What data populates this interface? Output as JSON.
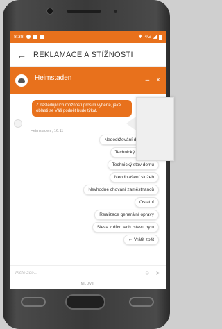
{
  "status_bar": {
    "time": "8:38",
    "network": "4G"
  },
  "app_bar": {
    "back_glyph": "←",
    "title": "REKLAMACE A STÍŽNOSTI"
  },
  "chat_header": {
    "name": "Heimstaden",
    "minimize_glyph": "–",
    "close_glyph": "×"
  },
  "message": {
    "text": "Z následujících možností prosím vyberte, jaké oblasti se Váš podnět bude týkat.",
    "meta": "Heimstaden , 16:11"
  },
  "options": [
    "Nedodržování dom. řádu",
    "Technický stav bytu",
    "Technický stav domu",
    "Neodhlášení služeb",
    "Nevhodné chování zaměstnanců",
    "Ostatní",
    "Realizace generální opravy",
    "Sleva z dův. tech. stavu bytu",
    "← Vrátit zpět"
  ],
  "input": {
    "placeholder": "Pište zde..."
  },
  "footer": {
    "powered_by": "MLUVII"
  },
  "colors": {
    "accent": "#e8711c"
  }
}
